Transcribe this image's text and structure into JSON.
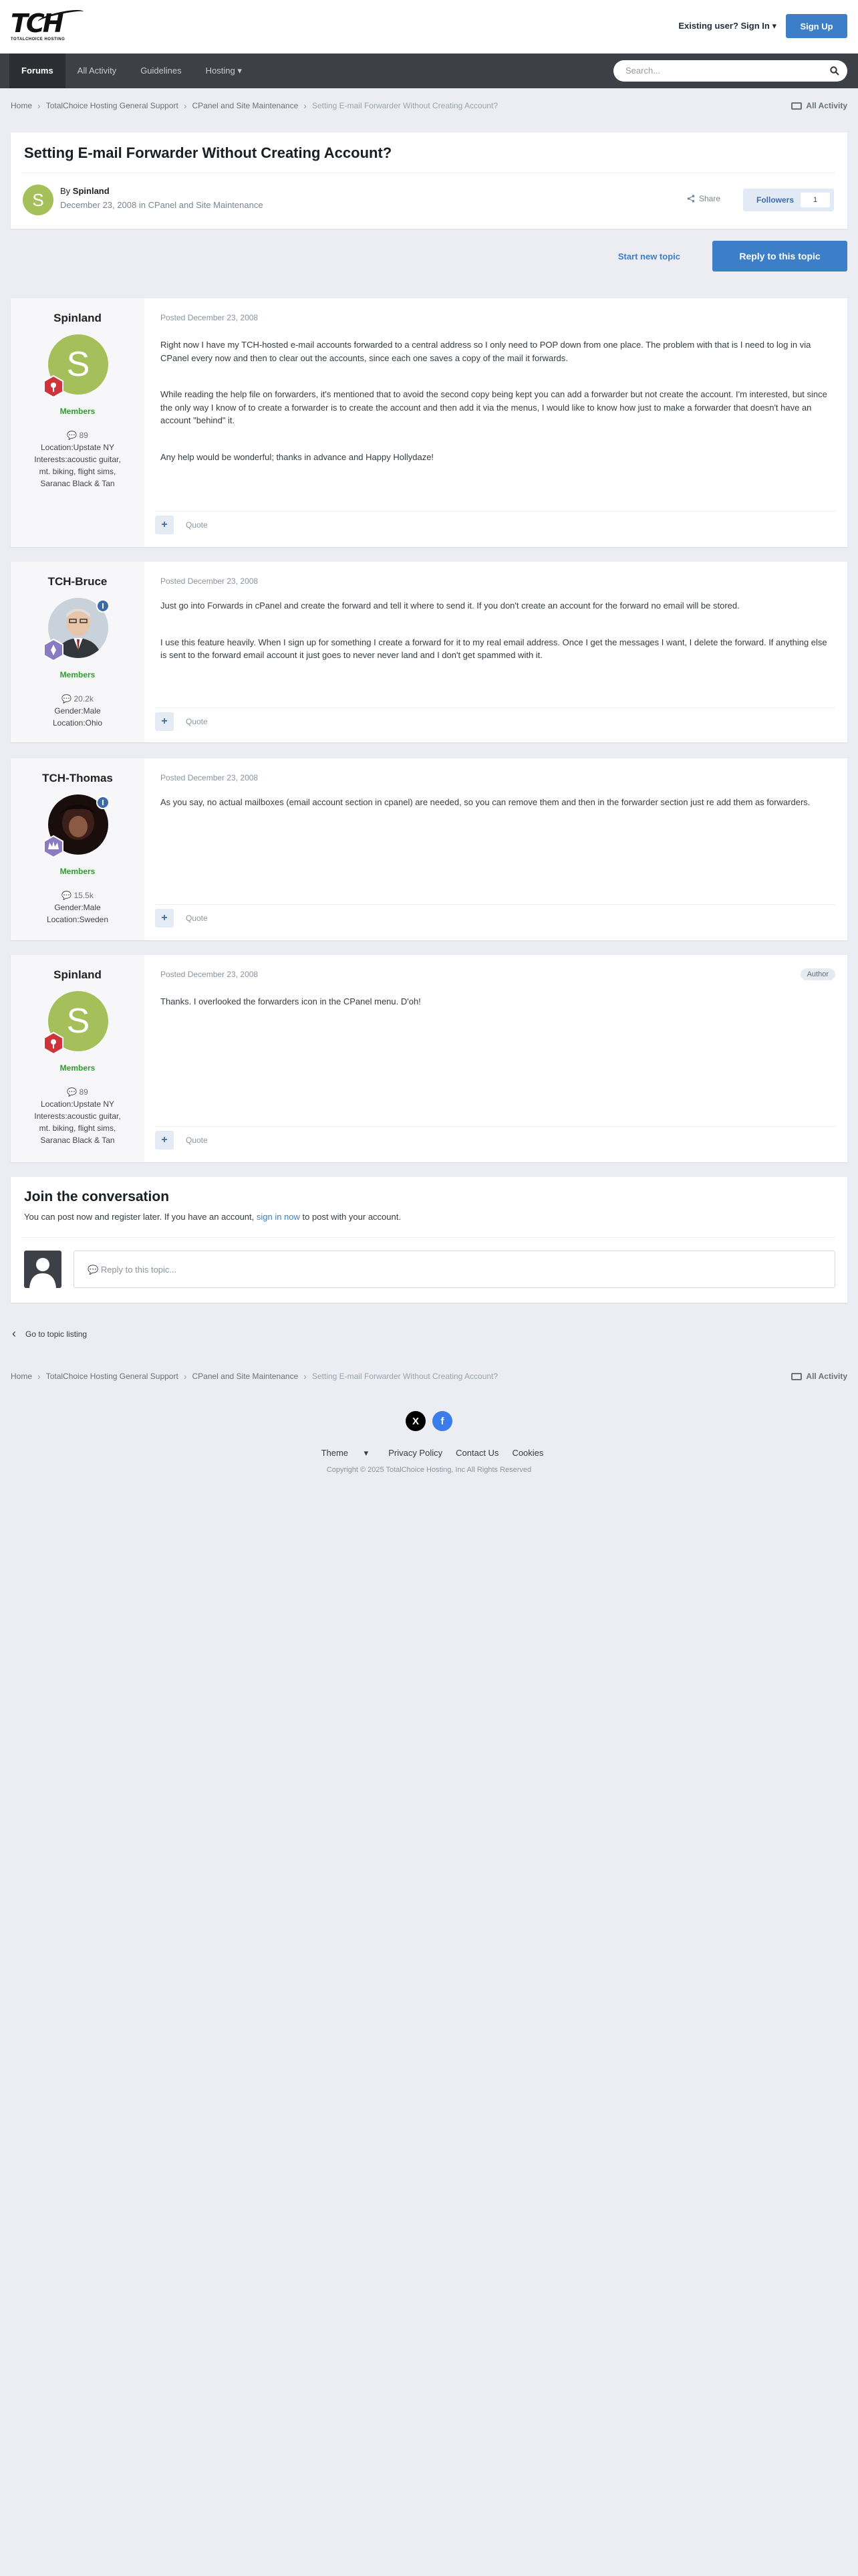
{
  "header": {
    "logo_text": "TCH",
    "logo_sub": "TOTALCHOICE HOSTING",
    "signin_label": "Existing user? Sign In",
    "signup_label": "Sign Up"
  },
  "nav": {
    "items": [
      {
        "label": "Forums",
        "active": true
      },
      {
        "label": "All Activity"
      },
      {
        "label": "Guidelines"
      },
      {
        "label": "Hosting"
      }
    ],
    "search_placeholder": "Search..."
  },
  "breadcrumb": {
    "items": [
      "Home",
      "TotalChoice Hosting General Support",
      "CPanel and Site Maintenance"
    ],
    "current": "Setting E-mail Forwarder Without Creating Account?",
    "all_activity": "All Activity"
  },
  "topic": {
    "title": "Setting E-mail Forwarder Without Creating Account?",
    "by_prefix": "By",
    "author": "Spinland",
    "date": "December 23, 2008",
    "in_label": "in",
    "forum": "CPanel and Site Maintenance",
    "share_label": "Share",
    "followers_label": "Followers",
    "followers_count": "1",
    "start_new_topic": "Start new topic",
    "reply_label": "Reply to this topic"
  },
  "posts": [
    {
      "author": "Spinland",
      "avatar_letter": "S",
      "group": "Members",
      "count": "89",
      "location": "Location:Upstate NY",
      "interests": "Interests:acoustic guitar, mt. biking, flight sims, Saranac Black & Tan",
      "posted": "Posted December 23, 2008",
      "paragraphs": [
        "Right now I have my TCH-hosted e-mail accounts forwarded to a central address so I only need to POP down from one place. The problem with that is I need to log in via CPanel every now and then to clear out the accounts, since each one saves a copy of the mail it forwards.",
        "While reading the help file on forwarders, it's mentioned that to avoid the second copy being kept you can add a forwarder but not create the account. I'm interested, but since the only way I know of to create a forwarder is to create the account and then add it via the menus, I would like to know how just to make a forwarder that doesn't have an account \"behind\" it.",
        "Any help would be wonderful; thanks in advance and Happy Hollydaze!"
      ]
    },
    {
      "author": "TCH-Bruce",
      "group": "Members",
      "count": "20.2k",
      "gender": "Gender:Male",
      "location": "Location:Ohio",
      "posted": "Posted December 23, 2008",
      "paragraphs": [
        "Just go into Forwards in cPanel and create the forward and tell it where to send it. If you don't create an account for the forward no email will be stored.",
        "I use this feature heavily. When I sign up for something I create a forward for it to my real email address. Once I get the messages I want, I delete the forward. If anything else is sent to the forward email account it just goes to never never land and I don't get spammed with it."
      ]
    },
    {
      "author": "TCH-Thomas",
      "group": "Members",
      "count": "15.5k",
      "gender": "Gender:Male",
      "location": "Location:Sweden",
      "posted": "Posted December 23, 2008",
      "paragraphs": [
        "As you say, no actual mailboxes (email account section in cpanel) are needed, so you can remove them and then in the forwarder section just re add them as forwarders."
      ]
    },
    {
      "author": "Spinland",
      "avatar_letter": "S",
      "group": "Members",
      "count": "89",
      "location": "Location:Upstate NY",
      "interests": "Interests:acoustic guitar, mt. biking, flight sims, Saranac Black & Tan",
      "posted": "Posted December 23, 2008",
      "badge": "Author",
      "paragraphs": [
        "Thanks. I overlooked the forwarders icon in the CPanel menu. D'oh!"
      ]
    }
  ],
  "post_controls": {
    "plus": "+",
    "quote": "Quote"
  },
  "join": {
    "title": "Join the conversation",
    "text_before": "You can post now and register later. If you have an account,",
    "link": "sign in now",
    "text_after": "to post with your account.",
    "reply_placeholder": "Reply to this topic..."
  },
  "go_to_listing": "Go to topic listing",
  "footer": {
    "social": [
      "X",
      "f"
    ],
    "links": [
      "Theme",
      "Privacy Policy",
      "Contact Us",
      "Cookies"
    ],
    "copyright": "Copyright © 2025 TotalChoice Hosting, Inc All Rights Reserved"
  },
  "colors": {
    "accent": "#3d7ec8",
    "nav_bg": "#3d4046",
    "members_green": "#2b9f2b",
    "page_bg": "#ebedf2"
  }
}
